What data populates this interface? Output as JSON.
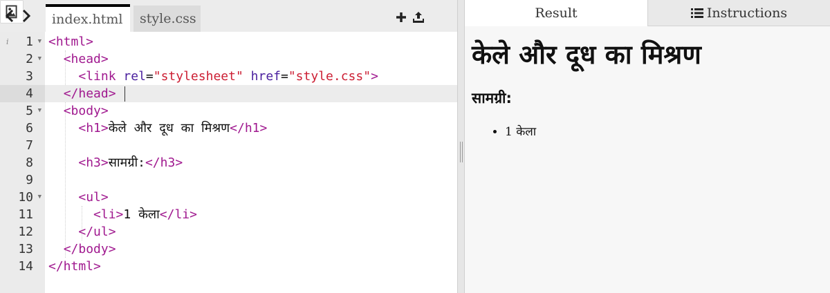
{
  "editor": {
    "tabs": [
      {
        "label": "index.html",
        "active": true
      },
      {
        "label": "style.css",
        "active": false
      }
    ],
    "tools": {
      "add_icon": "plus-icon",
      "upload_icon": "upload-icon",
      "image_icon": "image-icon"
    },
    "line_numbers": [
      "1",
      "2",
      "3",
      "4",
      "5",
      "6",
      "7",
      "8",
      "9",
      "10",
      "11",
      "12",
      "13",
      "14"
    ],
    "active_line": 4,
    "code_tokens": {
      "l1": {
        "open": "<html>"
      },
      "l2": {
        "open": "<head>"
      },
      "l3": {
        "tag_open": "<link",
        "attr1": "rel",
        "eq1": "=",
        "val1": "\"stylesheet\"",
        "attr2": "href",
        "eq2": "=",
        "val2": "\"style.css\"",
        "tag_close": ">"
      },
      "l4": {
        "close": "</head>"
      },
      "l5": {
        "open": "<body>"
      },
      "l6": {
        "open": "<h1>",
        "text": "केले और दूध का मिश्रण",
        "close": "</h1>"
      },
      "l8": {
        "open": "<h3>",
        "text": "सामग्री:",
        "close": "</h3>"
      },
      "l10": {
        "open": "<ul>"
      },
      "l11": {
        "open": "<li>",
        "text": "1 केला",
        "close": "</li>"
      },
      "l12": {
        "close": "</ul>"
      },
      "l13": {
        "close": "</body>"
      },
      "l14": {
        "close": "</html>"
      }
    }
  },
  "result": {
    "tabs": {
      "result": "Result",
      "instructions": "Instructions"
    },
    "instructions_icon": "list-icon",
    "preview": {
      "heading": "केले और दूध का मिश्रण",
      "subheading": "सामग्री:",
      "list": [
        "1 केला"
      ]
    }
  },
  "colors": {
    "tag": "#a0198f",
    "attr": "#4a1f9e",
    "string": "#cc1e33",
    "active_line_bg": "#ececec",
    "gutter_bg": "#ebebeb"
  }
}
